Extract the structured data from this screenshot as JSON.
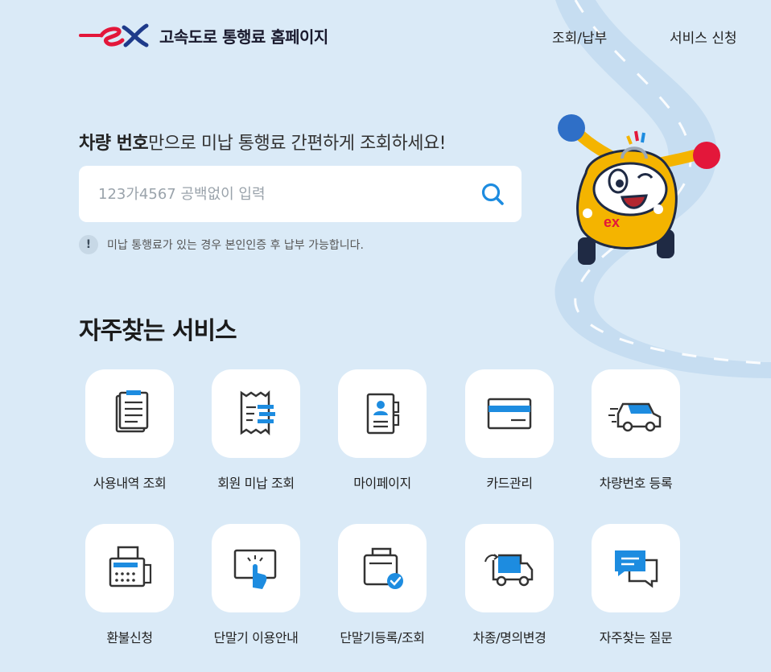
{
  "header": {
    "logo_text": "고속도로 통행료 홈페이지",
    "nav": [
      "조회/납부",
      "서비스 신청"
    ]
  },
  "search": {
    "title_bold": "차량 번호",
    "title_rest": "만으로 미납 통행료 간편하게 조회하세요!",
    "placeholder": "123가4567 공백없이 입력",
    "notice_icon": "!",
    "notice": "미납 통행료가 있는 경우 본인인증 후 납부 가능합니다."
  },
  "services": {
    "title": "자주찾는 서비스",
    "items": [
      {
        "label": "사용내역 조회",
        "icon": "clipboard-list-icon"
      },
      {
        "label": "회원 미납 조회",
        "icon": "receipt-icon"
      },
      {
        "label": "마이페이지",
        "icon": "profile-book-icon"
      },
      {
        "label": "카드관리",
        "icon": "credit-card-icon"
      },
      {
        "label": "차량번호 등록",
        "icon": "van-icon"
      },
      {
        "label": "환불신청",
        "icon": "fax-machine-icon"
      },
      {
        "label": "단말기 이용안내",
        "icon": "touch-terminal-icon"
      },
      {
        "label": "단말기등록/조회",
        "icon": "terminal-check-icon"
      },
      {
        "label": "차종/명의변경",
        "icon": "truck-change-icon"
      },
      {
        "label": "자주찾는 질문",
        "icon": "chat-bubbles-icon"
      }
    ]
  },
  "colors": {
    "background": "#daeaf7",
    "accent_blue": "#1d8ce0",
    "logo_red": "#e3173a",
    "logo_blue": "#1e3a8a"
  }
}
